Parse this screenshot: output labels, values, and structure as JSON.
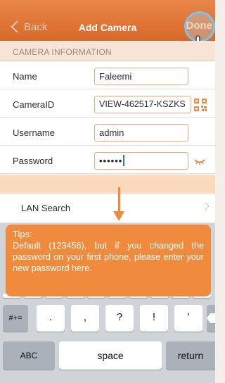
{
  "navbar": {
    "back_label": "Back",
    "title": "Add Camera",
    "done_label": "Done"
  },
  "section": {
    "header": "CAMERA INFORMATION"
  },
  "fields": [
    {
      "label": "Name",
      "value": "Faleemi"
    },
    {
      "label": "CameraID",
      "value": "VIEW-462517-KSZKS"
    },
    {
      "label": "Username",
      "value": "admin"
    },
    {
      "label": "Password",
      "value": "••••••"
    }
  ],
  "lan": {
    "label": "LAN Search"
  },
  "tips": {
    "title": "Tips:",
    "body": "Default (123456), but if you changed the password on your first phone, please enter your new password here."
  },
  "keyboard": {
    "row3": [
      "#+=",
      ".",
      ",",
      "?",
      "!",
      "'"
    ],
    "row4": [
      "ABC",
      "space",
      "return"
    ]
  },
  "colors": {
    "accent": "#e07a3a",
    "tip": "#f08a3c"
  }
}
